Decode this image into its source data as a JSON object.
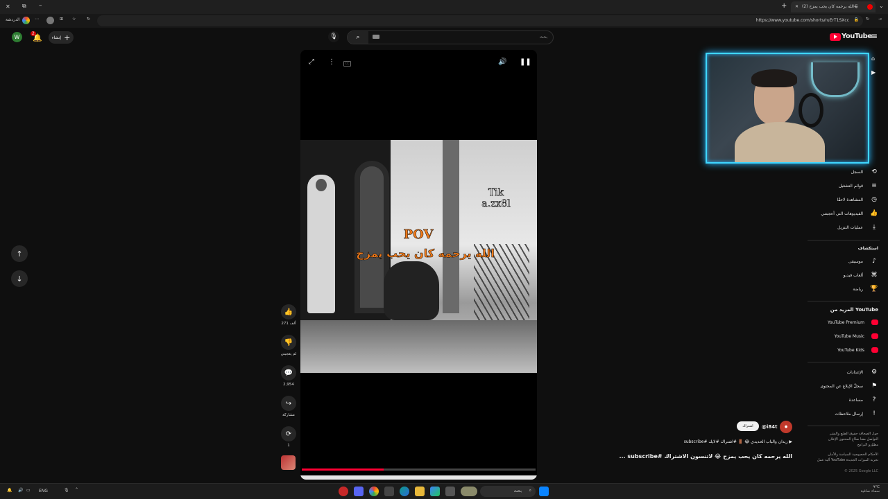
{
  "browser": {
    "tab_title": "(2) الله يرحمه كان يحب يمزح😂 #",
    "url": "https://www.youtube.com/shorts/ruErT1SXcc",
    "bookmark_label": "الدردشة",
    "new_tab": "+"
  },
  "header": {
    "logo_text": "YouTube",
    "search_placeholder": "بحث",
    "create_label": "إنشاء",
    "notif_count": "2",
    "avatar_letter": "W"
  },
  "sidebar": {
    "you_items": [
      {
        "label": "السجل",
        "icon": "history-icon",
        "glyph": "⟲"
      },
      {
        "label": "قوائم التشغيل",
        "icon": "playlist-icon",
        "glyph": "≡"
      },
      {
        "label": "المشاهدة لاحقًا",
        "icon": "clock-icon",
        "glyph": "◷"
      },
      {
        "label": "الفيديوهات التي أعجبتني",
        "icon": "like-icon",
        "glyph": "👍"
      },
      {
        "label": "عمليات التنزيل",
        "icon": "download-icon",
        "glyph": "⤓"
      }
    ],
    "explore_title": "استكشاف",
    "explore_items": [
      {
        "label": "موسيقى",
        "icon": "music-icon",
        "glyph": "♪"
      },
      {
        "label": "ألعاب فيديو",
        "icon": "gaming-icon",
        "glyph": "⌘"
      },
      {
        "label": "رياضة",
        "icon": "trophy-icon",
        "glyph": "🏆"
      }
    ],
    "more_title": "المزيد من YouTube",
    "more_items": [
      {
        "label": "YouTube Premium",
        "color": "#ff0033"
      },
      {
        "label": "YouTube Music",
        "color": "#ff0033"
      },
      {
        "label": "YouTube Kids",
        "color": "#ff0033"
      }
    ],
    "settings_items": [
      {
        "label": "الإعدادات",
        "icon": "gear-icon",
        "glyph": "⚙"
      },
      {
        "label": "سجلّ الإبلاغ عن المحتوى",
        "icon": "flag-icon",
        "glyph": "⚑"
      },
      {
        "label": "مساعدة",
        "icon": "help-icon",
        "glyph": "?"
      },
      {
        "label": "إرسال ملاحظات",
        "icon": "feedback-icon",
        "glyph": "!"
      }
    ],
    "footer_line1": "حول  الصحافة  حقوق الطبع والنشر",
    "footer_line2": "التواصل معنا  صنّاع المحتوى  الإعلان",
    "footer_line3": "مطوّرو البرامج",
    "footer_line4": "الأحكام  الخصوصية  السياسة والأمان",
    "footer_line5": "آلية عمل YouTube  تجربة الميزات الجديدة",
    "copyright": "© 2025 Google LLC"
  },
  "video": {
    "overlay_pov": "POV",
    "overlay_arabic": "الله يرحمه كان يحب يمزح",
    "watermark_line1": "Tik",
    "watermark_line2": "a.zx8l",
    "channel_handle": "@i84t",
    "subscribe_label": "اشتراك",
    "hashtags": "▶ زيدان والباب الحديدي 😂 🚪 #اشتراك #لايك #subscribe",
    "title": "الله يرحمه كان يحب يمزح 😂 لاتنسون الاشتراك #subscribe ...",
    "progress": 0.35
  },
  "actions": {
    "likes": "271 ألف",
    "dislike": "لم يعجبني",
    "comments": "2,954",
    "share": "مشاركة",
    "remix": "1"
  },
  "taskbar": {
    "lang": "ENG",
    "search_label": "بحث",
    "weather_temp": "٩°C",
    "weather_desc": "سماء صافية"
  }
}
